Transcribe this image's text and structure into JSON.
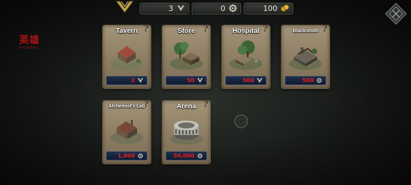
{
  "resources": [
    {
      "value": "3",
      "icon": "hero-token-icon"
    },
    {
      "value": "0",
      "icon": "gear-resource-icon"
    },
    {
      "value": "100",
      "icon": "gold-coin-icon"
    }
  ],
  "logo": {
    "text": "英雄",
    "sub": "ENSZSI"
  },
  "buildings": [
    {
      "name": "Tavern",
      "cost": "2",
      "cost_icon": "hero-token-icon"
    },
    {
      "name": "Store",
      "cost": "50",
      "cost_icon": "hero-token-icon"
    },
    {
      "name": "Hospital",
      "cost": "500",
      "cost_icon": "hero-token-icon"
    },
    {
      "name": "Blacksmith",
      "cost": "500",
      "cost_icon": "gear-resource-icon"
    },
    {
      "name": "Alchemist's Lab",
      "cost": "1,000",
      "cost_icon": "gear-resource-icon"
    },
    {
      "name": "Arena",
      "cost": "50,000",
      "cost_icon": "gear-resource-icon"
    }
  ],
  "help_glyph": "?",
  "colors": {
    "cost_text": "#e81e1e",
    "card_bg": "#998a6e",
    "cost_bg": "#16233d",
    "logo": "#b21214"
  }
}
